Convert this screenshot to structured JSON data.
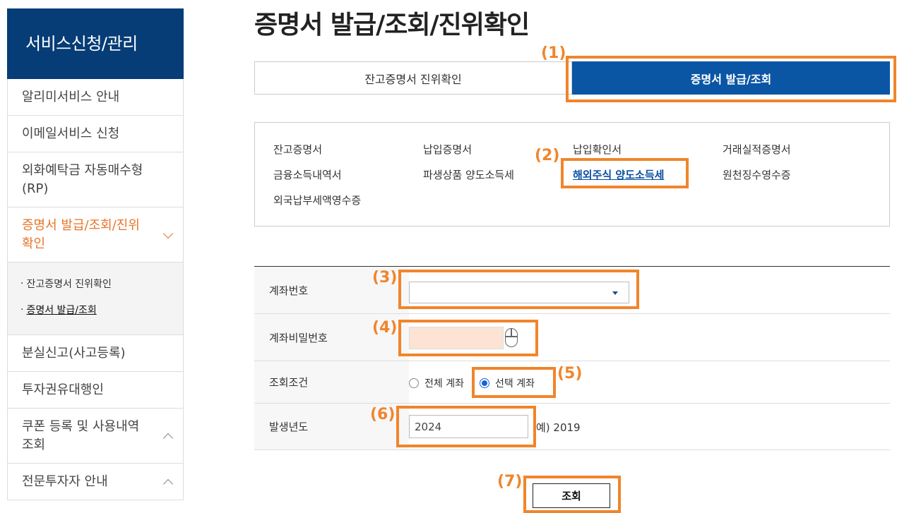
{
  "sidebar": {
    "title": "서비스신청/관리",
    "items": [
      {
        "label": "알리미서비스 안내"
      },
      {
        "label": "이메일서비스 신청"
      },
      {
        "label": "외화예탁금 자동매수형(RP)"
      },
      {
        "label": "증명서 발급/조회/진위확인"
      },
      {
        "label": "분실신고(사고등록)"
      },
      {
        "label": "투자권유대행인"
      },
      {
        "label": "쿠폰 등록 및 사용내역 조회"
      },
      {
        "label": "전문투자자 안내"
      }
    ],
    "submenu": [
      {
        "label": "잔고증명서 진위확인"
      },
      {
        "label": "증명서 발급/조회"
      }
    ]
  },
  "page_title": "증명서 발급/조회/진위확인",
  "tabs": [
    {
      "label": "잔고증명서 진위확인"
    },
    {
      "label": "증명서 발급/조회"
    }
  ],
  "documents": [
    "잔고증명서",
    "납입증명서",
    "납입확인서",
    "거래실적증명서",
    "금융소득내역서",
    "파생상품 양도소득세",
    "해외주식 양도소득세",
    "원천징수영수증",
    "외국납부세액영수증"
  ],
  "form": {
    "account_label": "계좌번호",
    "account_value": "",
    "password_label": "계좌비밀번호",
    "condition_label": "조회조건",
    "option_all": "전체 계좌",
    "option_selected": "선택 계좌",
    "year_label": "발생년도",
    "year_value": "2024",
    "year_hint": "예) 2019"
  },
  "search_button": "조회",
  "annotations": [
    "(1)",
    "(2)",
    "(3)",
    "(4)",
    "(5)",
    "(6)",
    "(7)"
  ],
  "colors": {
    "sidebar_header": "#063d76",
    "active_tab": "#0a56a5",
    "annotation": "#f0852b",
    "active_menu": "#e8742a"
  }
}
